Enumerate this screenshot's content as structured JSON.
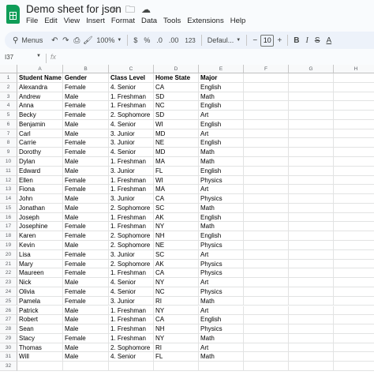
{
  "doc_title": "Demo sheet for json",
  "title_icons": [
    "star-icon",
    "move-to-folder-icon",
    "cloud-saved-icon"
  ],
  "menu": [
    "File",
    "Edit",
    "View",
    "Insert",
    "Format",
    "Data",
    "Tools",
    "Extensions",
    "Help"
  ],
  "toolbar": {
    "menus_label": "Menus",
    "zoom": "100%",
    "currency": "$",
    "percent": "%",
    "decimal_decrease": ".0",
    "decimal_increase": ".00",
    "number_format": "123",
    "font": "Defaul...",
    "font_size": "10",
    "bold": "B",
    "italic": "I",
    "strikethrough": "S",
    "text_color": "A"
  },
  "formula_bar": {
    "name_box": "I37",
    "fx": "fx",
    "value": ""
  },
  "columns": [
    "A",
    "B",
    "C",
    "D",
    "E",
    "F",
    "G",
    "H"
  ],
  "rows": [
    [
      "Student Name",
      "Gender",
      "Class Level",
      "Home State",
      "Major"
    ],
    [
      "Alexandra",
      "Female",
      "4. Senior",
      "CA",
      "English"
    ],
    [
      "Andrew",
      "Male",
      "1. Freshman",
      "SD",
      "Math"
    ],
    [
      "Anna",
      "Female",
      "1. Freshman",
      "NC",
      "English"
    ],
    [
      "Becky",
      "Female",
      "2. Sophomore",
      "SD",
      "Art"
    ],
    [
      "Benjamin",
      "Male",
      "4. Senior",
      "WI",
      "English"
    ],
    [
      "Carl",
      "Male",
      "3. Junior",
      "MD",
      "Art"
    ],
    [
      "Carrie",
      "Female",
      "3. Junior",
      "NE",
      "English"
    ],
    [
      "Dorothy",
      "Female",
      "4. Senior",
      "MD",
      "Math"
    ],
    [
      "Dylan",
      "Male",
      "1. Freshman",
      "MA",
      "Math"
    ],
    [
      "Edward",
      "Male",
      "3. Junior",
      "FL",
      "English"
    ],
    [
      "Ellen",
      "Female",
      "1. Freshman",
      "WI",
      "Physics"
    ],
    [
      "Fiona",
      "Female",
      "1. Freshman",
      "MA",
      "Art"
    ],
    [
      "John",
      "Male",
      "3. Junior",
      "CA",
      "Physics"
    ],
    [
      "Jonathan",
      "Male",
      "2. Sophomore",
      "SC",
      "Math"
    ],
    [
      "Joseph",
      "Male",
      "1. Freshman",
      "AK",
      "English"
    ],
    [
      "Josephine",
      "Female",
      "1. Freshman",
      "NY",
      "Math"
    ],
    [
      "Karen",
      "Female",
      "2. Sophomore",
      "NH",
      "English"
    ],
    [
      "Kevin",
      "Male",
      "2. Sophomore",
      "NE",
      "Physics"
    ],
    [
      "Lisa",
      "Female",
      "3. Junior",
      "SC",
      "Art"
    ],
    [
      "Mary",
      "Female",
      "2. Sophomore",
      "AK",
      "Physics"
    ],
    [
      "Maureen",
      "Female",
      "1. Freshman",
      "CA",
      "Physics"
    ],
    [
      "Nick",
      "Male",
      "4. Senior",
      "NY",
      "Art"
    ],
    [
      "Olivia",
      "Female",
      "4. Senior",
      "NC",
      "Physics"
    ],
    [
      "Pamela",
      "Female",
      "3. Junior",
      "RI",
      "Math"
    ],
    [
      "Patrick",
      "Male",
      "1. Freshman",
      "NY",
      "Art"
    ],
    [
      "Robert",
      "Male",
      "1. Freshman",
      "CA",
      "English"
    ],
    [
      "Sean",
      "Male",
      "1. Freshman",
      "NH",
      "Physics"
    ],
    [
      "Stacy",
      "Female",
      "1. Freshman",
      "NY",
      "Math"
    ],
    [
      "Thomas",
      "Male",
      "2. Sophomore",
      "RI",
      "Art"
    ],
    [
      "Will",
      "Male",
      "4. Senior",
      "FL",
      "Math"
    ],
    [
      "",
      "",
      "",
      "",
      ""
    ]
  ]
}
